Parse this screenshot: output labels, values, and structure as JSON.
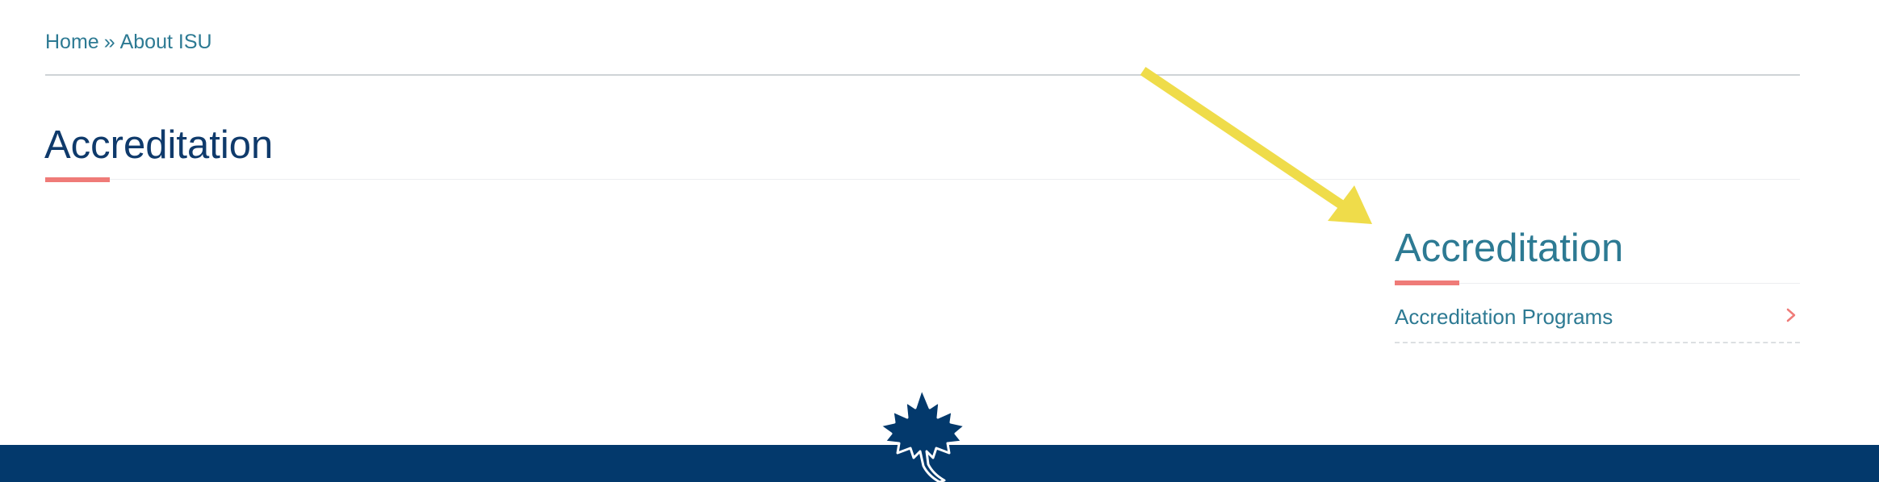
{
  "breadcrumb": {
    "home_label": "Home",
    "separator": "»",
    "current_label": "About ISU"
  },
  "page": {
    "title": "Accreditation"
  },
  "sidebar": {
    "title": "Accreditation",
    "items": [
      {
        "label": "Accreditation Programs",
        "icon": "chevron-right-icon"
      }
    ]
  },
  "annotation": {
    "arrow_color": "#efdc4a"
  },
  "footer": {
    "background_color": "#03396c",
    "logo_icon": "maple-leaf-icon"
  },
  "colors": {
    "link": "#2d7a93",
    "title": "#0f3a6b",
    "accent": "#ef7b78"
  }
}
